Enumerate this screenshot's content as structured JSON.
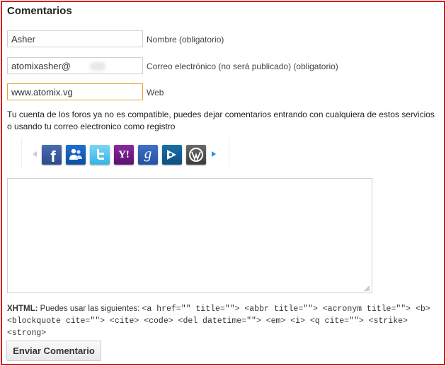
{
  "section": {
    "title": "Comentarios"
  },
  "form": {
    "name": {
      "value": "Asher",
      "label": "Nombre (obligatorio)"
    },
    "email": {
      "value": "atomixasher@",
      "label": "Correo electrónico (no será publicado) (obligatorio)"
    },
    "web": {
      "value": "www.atomix.vg",
      "label": "Web"
    },
    "comment": {
      "value": ""
    }
  },
  "notice": "Tu cuenta de los foros ya no es compatible, puedes dejar comentarios entrando con cualquiera de estos servicios o usando tu correo electronico como registro",
  "social": {
    "icons": [
      "facebook-icon",
      "messenger-icon",
      "twitter-icon",
      "yahoo-icon",
      "google-icon",
      "gigya-icon",
      "wordpress-icon"
    ],
    "facebook": "f",
    "yahoo": "Y!",
    "google": "g"
  },
  "xhtml": {
    "label": "XHTML:",
    "text": "Puedes usar las siguientes:",
    "tags": "<a href=\"\" title=\"\"> <abbr title=\"\"> <acronym title=\"\"> <b> <blockquote cite=\"\"> <cite> <code> <del datetime=\"\"> <em> <i> <q cite=\"\"> <strike> <strong>"
  },
  "submit": {
    "label": "Enviar Comentario"
  },
  "colors": {
    "frame": "#e01b1b",
    "focus": "#e8a33a"
  }
}
